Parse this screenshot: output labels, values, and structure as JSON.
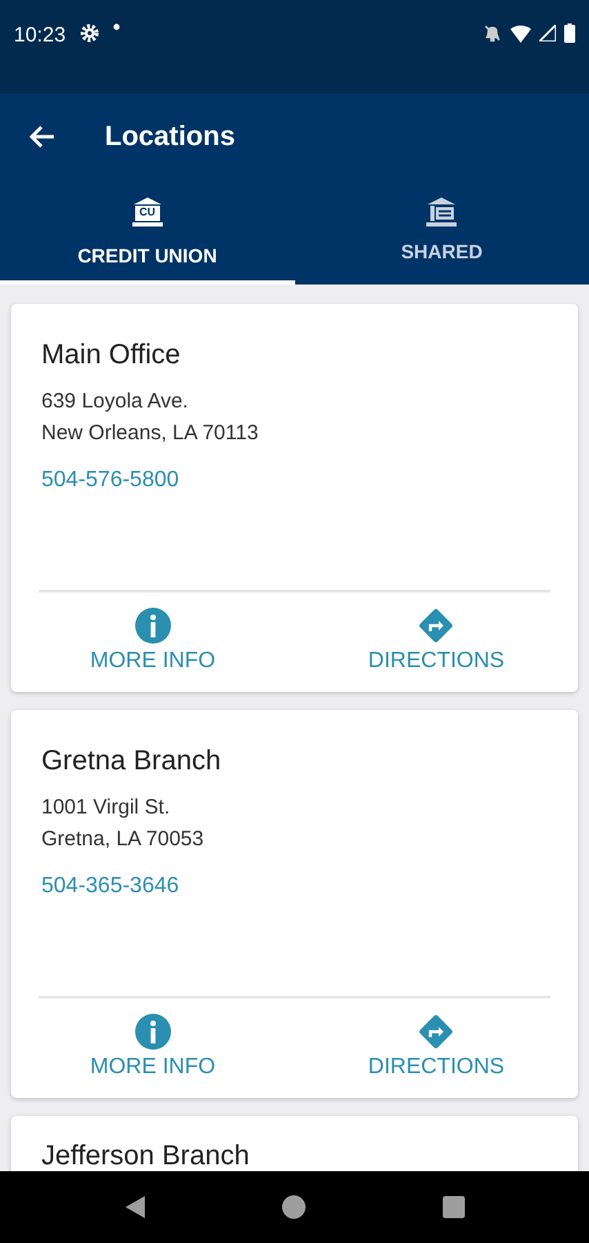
{
  "status_bar": {
    "time": "10:23"
  },
  "app_bar": {
    "title": "Locations"
  },
  "tabs": [
    {
      "label": "CREDIT UNION",
      "icon_label": "CU",
      "kind": "cu",
      "selected": true
    },
    {
      "label": "SHARED",
      "kind": "shared",
      "selected": false
    }
  ],
  "locations": [
    {
      "name": "Main Office",
      "address_lines": [
        "639 Loyola Ave.",
        "New Orleans, LA 70113"
      ],
      "phone": "504-576-5800",
      "actions": [
        "MORE INFO",
        "DIRECTIONS"
      ]
    },
    {
      "name": "Gretna Branch",
      "address_lines": [
        "1001 Virgil St.",
        "Gretna, LA 70053"
      ],
      "phone": "504-365-3646",
      "actions": [
        "MORE INFO",
        "DIRECTIONS"
      ]
    },
    {
      "name": "Jefferson Branch"
    }
  ]
}
